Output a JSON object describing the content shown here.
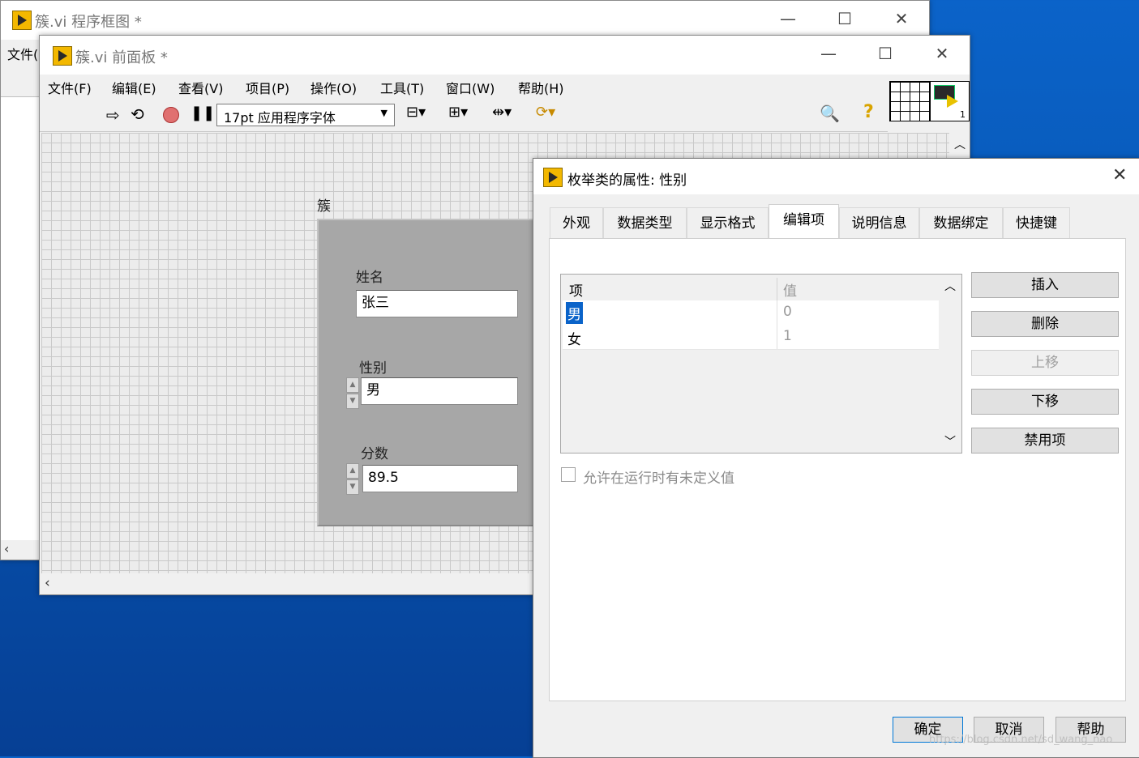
{
  "back_window": {
    "title": "簇.vi 程序框图 *",
    "menu_partial": "文件("
  },
  "front_panel": {
    "title": "簇.vi 前面板 *",
    "menu": [
      "文件(F)",
      "编辑(E)",
      "查看(V)",
      "项目(P)",
      "操作(O)",
      "工具(T)",
      "窗口(W)",
      "帮助(H)"
    ],
    "font_select": "17pt 应用程序字体",
    "cluster_label": "簇",
    "name_label": "姓名",
    "name_value": "张三",
    "gender_label": "性别",
    "gender_value": "男",
    "score_label": "分数",
    "score_value": "89.5",
    "connector_count": "1"
  },
  "dialog": {
    "title": "枚举类的属性: 性别",
    "tabs": [
      "外观",
      "数据类型",
      "显示格式",
      "编辑项",
      "说明信息",
      "数据绑定",
      "快捷键"
    ],
    "active_tab": "编辑项",
    "table": {
      "headers": [
        "项",
        "值"
      ],
      "rows": [
        {
          "item": "男",
          "value": "0"
        },
        {
          "item": "女",
          "value": "1"
        }
      ]
    },
    "side_buttons": {
      "insert": "插入",
      "delete": "删除",
      "move_up": "上移",
      "move_down": "下移",
      "disable": "禁用项"
    },
    "checkbox_label": "允许在运行时有未定义值",
    "checkbox_checked": false,
    "bottom_buttons": {
      "ok": "确定",
      "cancel": "取消",
      "help": "帮助"
    },
    "watermark": "https://blog.csdn.net/sd_wang_nao"
  },
  "colors": {
    "cluster_bg": "#a7a7a7",
    "selected_item": "#0a63c9",
    "desktop": "#0757b5",
    "lv_icon": "#f3b800"
  }
}
